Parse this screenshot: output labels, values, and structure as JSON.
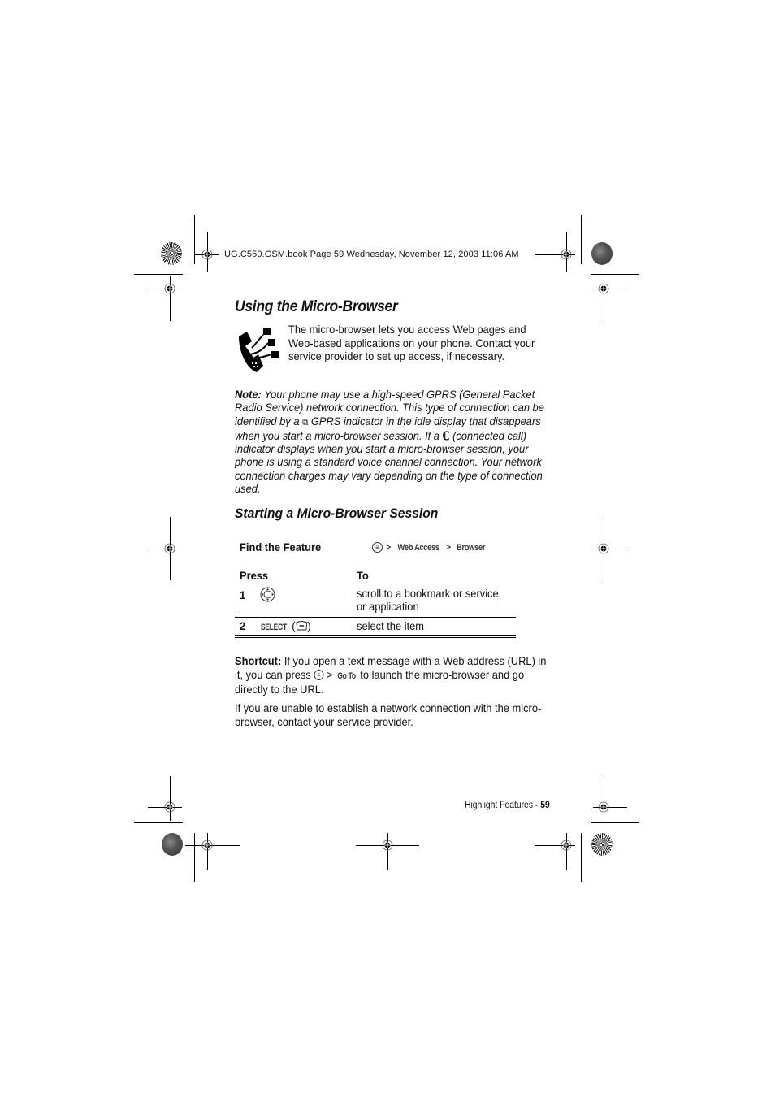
{
  "header": {
    "slug": "UG.C550.GSM.book  Page 59  Wednesday, November 12, 2003  11:06 AM"
  },
  "section": {
    "title": "Using the Micro-Browser",
    "icon": "phone-web-icon",
    "intro": "The micro-browser lets you access Web pages and Web-based applications on your phone. Contact your service provider to set up access, if necessary."
  },
  "note": {
    "label": "Note:",
    "text_1": " Your phone may use a high-speed GPRS (General Packet Radio Service) network connection. This type of connection can be identified by a ",
    "gprs_icon": "gprs-indicator-icon",
    "text_2": " GPRS indicator in the idle display that disappears when you start a micro-browser session. If a ",
    "call_icon": "connected-call-icon",
    "text_3": " (connected call) indicator displays when you start a micro-browser session, your phone is using a standard voice channel connection. Your network connection charges may vary depending on the type of connection used."
  },
  "subsection": {
    "title": "Starting a Micro-Browser Session"
  },
  "find_feature": {
    "label": "Find the Feature",
    "menu_key_icon": "menu-key-icon",
    "sep1": " > ",
    "item1": "Web Access",
    "sep2": " > ",
    "item2": "Browser"
  },
  "table": {
    "headers": [
      "Press",
      "To"
    ],
    "rows": [
      {
        "num": "1",
        "press_icon": "nav-key-icon",
        "press_label": "",
        "to": "scroll to a bookmark or service, or application"
      },
      {
        "num": "2",
        "press_label": "SELECT",
        "press_icon": "soft-key-icon",
        "to": "select the item"
      }
    ]
  },
  "shortcut": {
    "label": "Shortcut:",
    "text_1": " If you open a text message with a Web address (URL) in it, you can press ",
    "sep": " > ",
    "item": "Go To",
    "text_2": " to launch the micro-browser and go directly to the URL."
  },
  "closing": "If you are unable to establish a network connection with the micro-browser, contact your service provider.",
  "footer": {
    "section": "Highlight Features - ",
    "page": "59"
  }
}
